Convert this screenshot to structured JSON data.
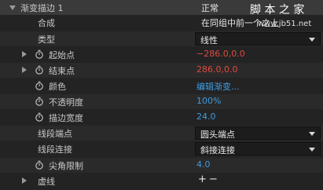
{
  "watermark": {
    "text": "脚 本 之 家",
    "url": "www.jb51.net"
  },
  "rows": [
    {
      "label": "渐变描边 1",
      "value": "正常"
    },
    {
      "label": "合成",
      "value": "在同组中前一个之上"
    },
    {
      "label": "类型",
      "value": "线性"
    },
    {
      "label": "起始点",
      "value": "−286.0,0.0"
    },
    {
      "label": "结束点",
      "value": "286.0,0.0"
    },
    {
      "label": "颜色",
      "value": "编辑渐变..."
    },
    {
      "label": "不透明度",
      "value": "100%"
    },
    {
      "label": "描边宽度",
      "value": "24.0"
    },
    {
      "label": "线段端点",
      "value": "圆头端点"
    },
    {
      "label": "线段连接",
      "value": "斜接连接"
    },
    {
      "label": "尖角限制",
      "value": "4.0"
    },
    {
      "label": "虚线",
      "value": ""
    }
  ],
  "dash_controls": {
    "add": "+",
    "remove": "−"
  },
  "colors": {
    "background": "#232323",
    "red_value": "#e04a3f",
    "blue_value": "#3d9be0"
  }
}
